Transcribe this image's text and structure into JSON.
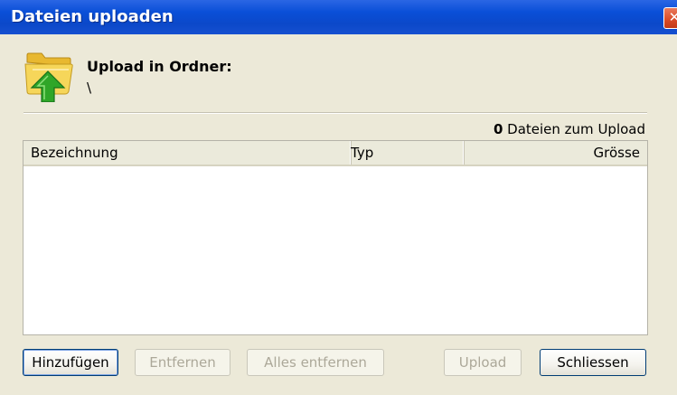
{
  "window": {
    "title": "Dateien uploaden",
    "close_glyph": "✕"
  },
  "header": {
    "icon": "folder-upload-icon",
    "label": "Upload in Ordner:",
    "path": "\\"
  },
  "summary": {
    "count": "0",
    "count_text": "Dateien zum Upload"
  },
  "file_list": {
    "columns": [
      "Bezeichnung",
      "Typ",
      "Grösse"
    ],
    "rows": []
  },
  "buttons": {
    "add": "Hinzufügen",
    "remove": "Entfernen",
    "remove_all": "Alles entfernen",
    "upload": "Upload",
    "close": "Schliessen"
  },
  "colors": {
    "titlebar": "#0b48c9",
    "dialog_bg": "#ece9d8",
    "folder_yellow": "#f2cf4a",
    "arrow_green": "#2fa628"
  }
}
